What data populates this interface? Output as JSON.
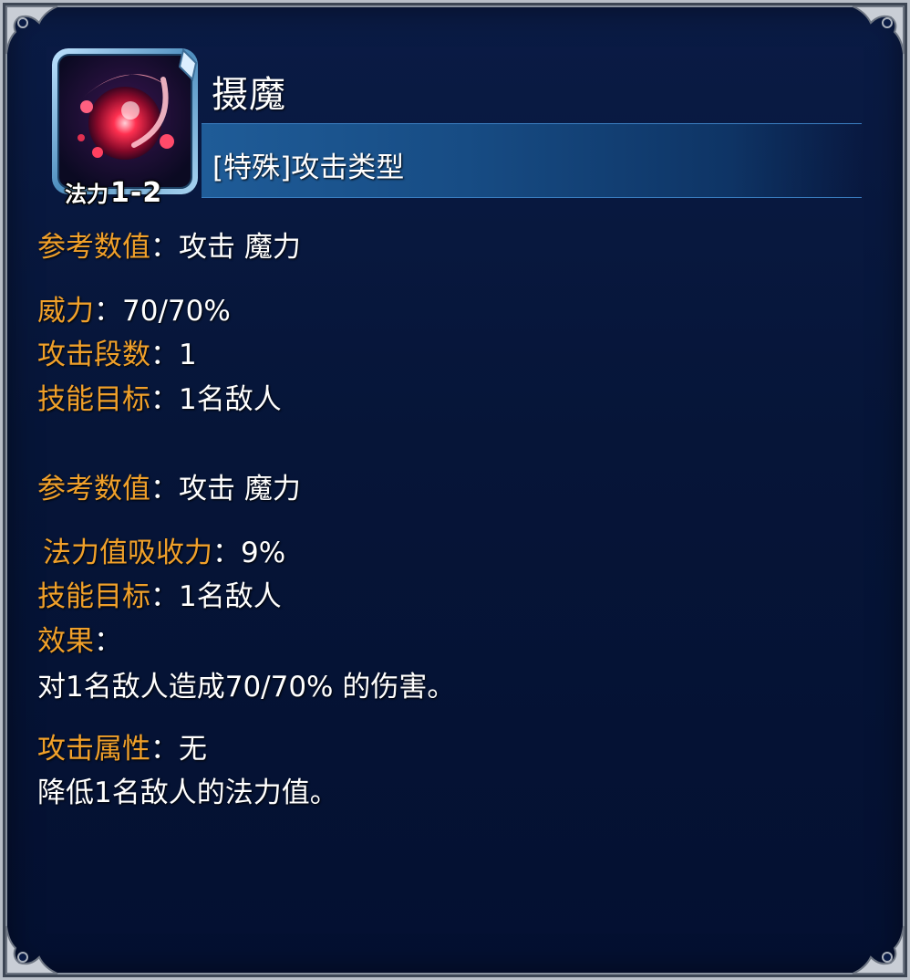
{
  "skill": {
    "name": "摄魔",
    "type": "[特殊]攻击类型",
    "mp_label": "法力",
    "mp_cost": "1-2",
    "icon": "magic-orb-icon"
  },
  "colors": {
    "label": "#f0a02a",
    "value": "#ffffff",
    "panel_bg": "#061538",
    "type_bar": "#1f5c98"
  },
  "block1": {
    "ref_label": "参考数值",
    "ref_value": "攻击 魔力",
    "power_label": "威力",
    "power_value": "70/70%",
    "hits_label": "攻击段数",
    "hits_value": "1",
    "target_label": "技能目标",
    "target_value": "1名敌人"
  },
  "block2": {
    "ref_label": "参考数值",
    "ref_value": "攻击 魔力",
    "drain_label": "法力值吸收力",
    "drain_value": "9%",
    "target_label": "技能目标",
    "target_value": "1名敌人",
    "effect_label": "效果",
    "effect_text": "对1名敌人造成70/70% 的伤害。",
    "element_label": "攻击属性",
    "element_value": "无",
    "desc_text": "降低1名敌人的法力值。"
  },
  "separator": "："
}
